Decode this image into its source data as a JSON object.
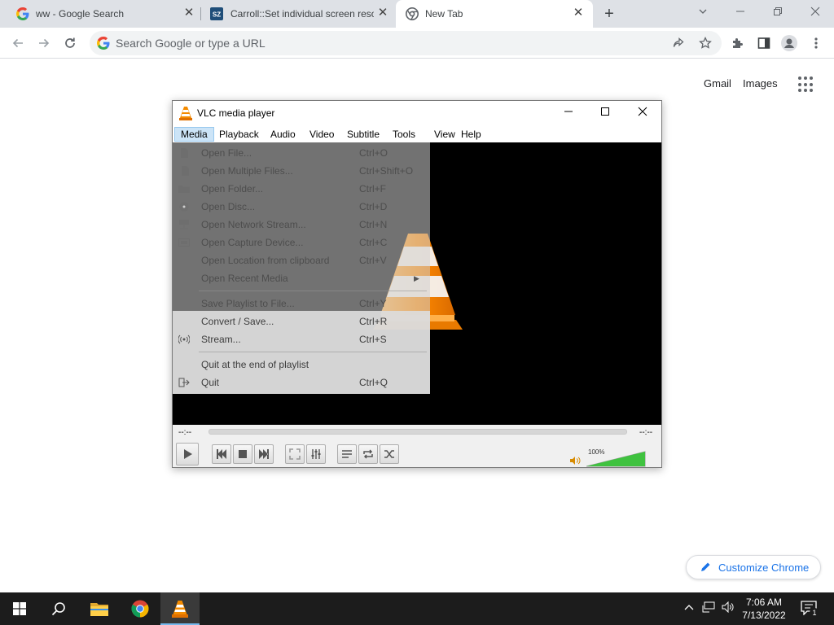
{
  "browser": {
    "tabs": [
      {
        "title": "ww - Google Search",
        "favicon": "google-icon",
        "active": false
      },
      {
        "title": "Carroll::Set individual screen reso",
        "favicon": "sz-icon",
        "active": false
      },
      {
        "title": "New Tab",
        "favicon": "chrome-icon",
        "active": true
      }
    ],
    "omnibox_placeholder": "Search Google or type a URL",
    "ntp": {
      "gmail": "Gmail",
      "images": "Images",
      "customize": "Customize Chrome"
    }
  },
  "vlc": {
    "title": "VLC media player",
    "menubar": [
      "Media",
      "Playback",
      "Audio",
      "Video",
      "Subtitle",
      "Tools",
      "View",
      "Help"
    ],
    "open_menu": "Media",
    "media_menu": [
      {
        "label": "Open File...",
        "shortcut": "Ctrl+O",
        "icon": "file-icon"
      },
      {
        "label": "Open Multiple Files...",
        "shortcut": "Ctrl+Shift+O",
        "icon": "files-icon"
      },
      {
        "label": "Open Folder...",
        "shortcut": "Ctrl+F",
        "icon": "folder-icon"
      },
      {
        "label": "Open Disc...",
        "shortcut": "Ctrl+D",
        "icon": "disc-icon"
      },
      {
        "label": "Open Network Stream...",
        "shortcut": "Ctrl+N",
        "icon": "network-icon"
      },
      {
        "label": "Open Capture Device...",
        "shortcut": "Ctrl+C",
        "icon": "capture-icon"
      },
      {
        "label": "Open Location from clipboard",
        "shortcut": "Ctrl+V",
        "icon": ""
      },
      {
        "label": "Open Recent Media",
        "shortcut": "",
        "icon": "",
        "submenu": true
      },
      {
        "label": "Save Playlist to File...",
        "shortcut": "Ctrl+Y",
        "icon": ""
      },
      {
        "label": "Convert / Save...",
        "shortcut": "Ctrl+R",
        "icon": ""
      },
      {
        "label": "Stream...",
        "shortcut": "Ctrl+S",
        "icon": "stream-icon"
      },
      {
        "label": "Quit at the end of playlist",
        "shortcut": "",
        "icon": ""
      },
      {
        "label": "Quit",
        "shortcut": "Ctrl+Q",
        "icon": "quit-icon"
      }
    ],
    "time_elapsed": "--:--",
    "time_total": "--:--",
    "volume_label": "100%",
    "volume_level": 1.0,
    "accent": "#ff8800"
  },
  "taskbar": {
    "time": "7:06 AM",
    "date": "7/13/2022",
    "notification_count": "1"
  }
}
